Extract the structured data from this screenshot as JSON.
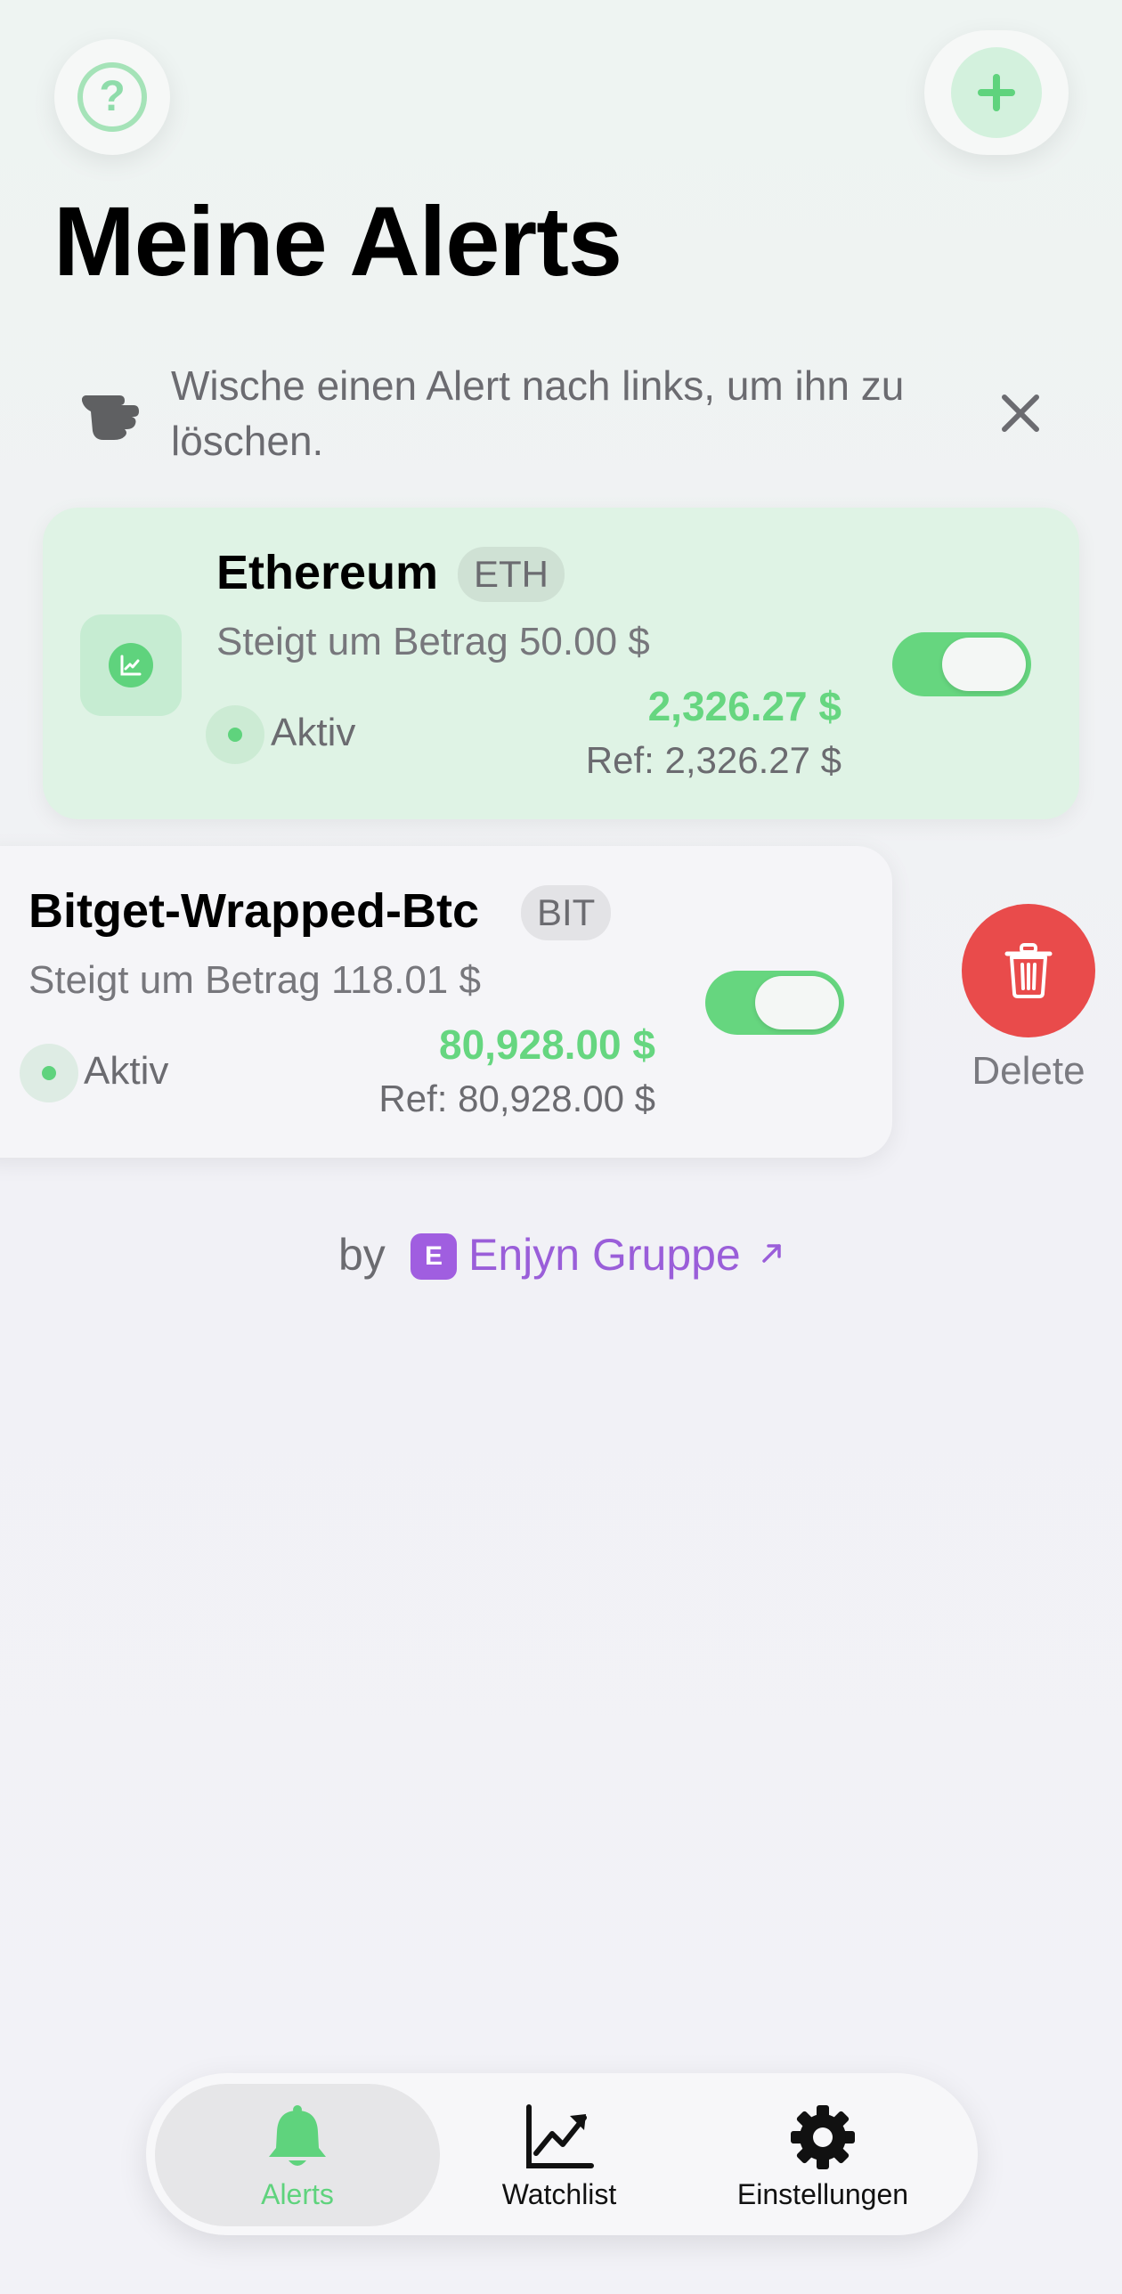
{
  "header": {
    "title": "Meine Alerts",
    "help_icon": "question-circle-icon",
    "add_icon": "plus-icon"
  },
  "hint": {
    "text": "Wische einen Alert nach links, um ihn zu löschen.",
    "icon": "pointing-hand-icon",
    "close_icon": "close-icon"
  },
  "alerts": [
    {
      "name": "Ethereum",
      "ticker": "ETH",
      "condition": "Steigt um Betrag 50.00 $",
      "status": "Aktiv",
      "price": "2,326.27 $",
      "ref": "Ref: 2,326.27 $",
      "enabled": true,
      "icon": "chart-up-icon"
    },
    {
      "name": "Bitget-Wrapped-Btc",
      "ticker": "BIT",
      "condition": "Steigt um Betrag 118.01 $",
      "status": "Aktiv",
      "price": "80,928.00 $",
      "ref": "Ref: 80,928.00 $",
      "enabled": true
    }
  ],
  "swipe_action": {
    "label": "Delete",
    "icon": "trash-icon"
  },
  "credit": {
    "by": "by",
    "badge": "E",
    "brand": "Enjyn Gruppe",
    "link_icon": "arrow-up-right-icon"
  },
  "tabs": [
    {
      "label": "Alerts",
      "icon": "bell-icon",
      "active": true
    },
    {
      "label": "Watchlist",
      "icon": "chart-trend-icon",
      "active": false
    },
    {
      "label": "Einstellungen",
      "icon": "gear-icon",
      "active": false
    }
  ],
  "colors": {
    "accent_green": "#66d680",
    "delete_red": "#e94b4b",
    "brand_purple": "#9a5ed9"
  }
}
